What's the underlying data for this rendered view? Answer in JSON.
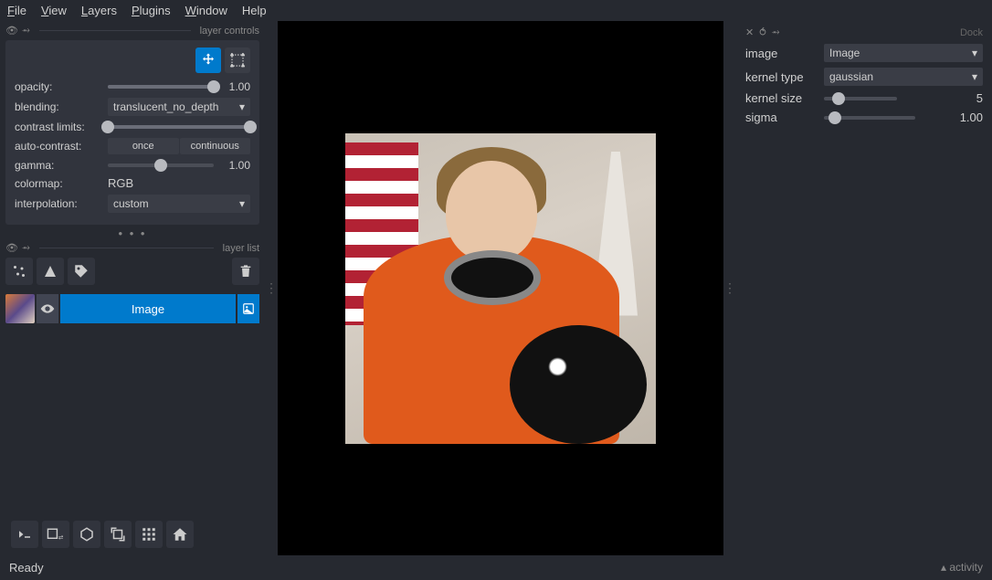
{
  "menu": {
    "file": "File",
    "view": "View",
    "layers": "Layers",
    "plugins": "Plugins",
    "window": "Window",
    "help": "Help"
  },
  "layer_controls": {
    "title": "layer controls",
    "opacity": {
      "label": "opacity:",
      "value": "1.00"
    },
    "blending": {
      "label": "blending:",
      "value": "translucent_no_depth"
    },
    "contrast": {
      "label": "contrast limits:"
    },
    "autocontrast": {
      "label": "auto-contrast:",
      "once": "once",
      "continuous": "continuous"
    },
    "gamma": {
      "label": "gamma:",
      "value": "1.00"
    },
    "colormap": {
      "label": "colormap:",
      "value": "RGB"
    },
    "interpolation": {
      "label": "interpolation:",
      "value": "custom"
    }
  },
  "layer_list": {
    "title": "layer list",
    "item_name": "Image"
  },
  "dock": {
    "title": "Dock",
    "image": {
      "label": "image",
      "value": "Image"
    },
    "kernel_type": {
      "label": "kernel type",
      "value": "gaussian"
    },
    "kernel_size": {
      "label": "kernel size",
      "value": "5"
    },
    "sigma": {
      "label": "sigma",
      "value": "1.00"
    }
  },
  "status": {
    "ready": "Ready",
    "activity": "activity"
  }
}
